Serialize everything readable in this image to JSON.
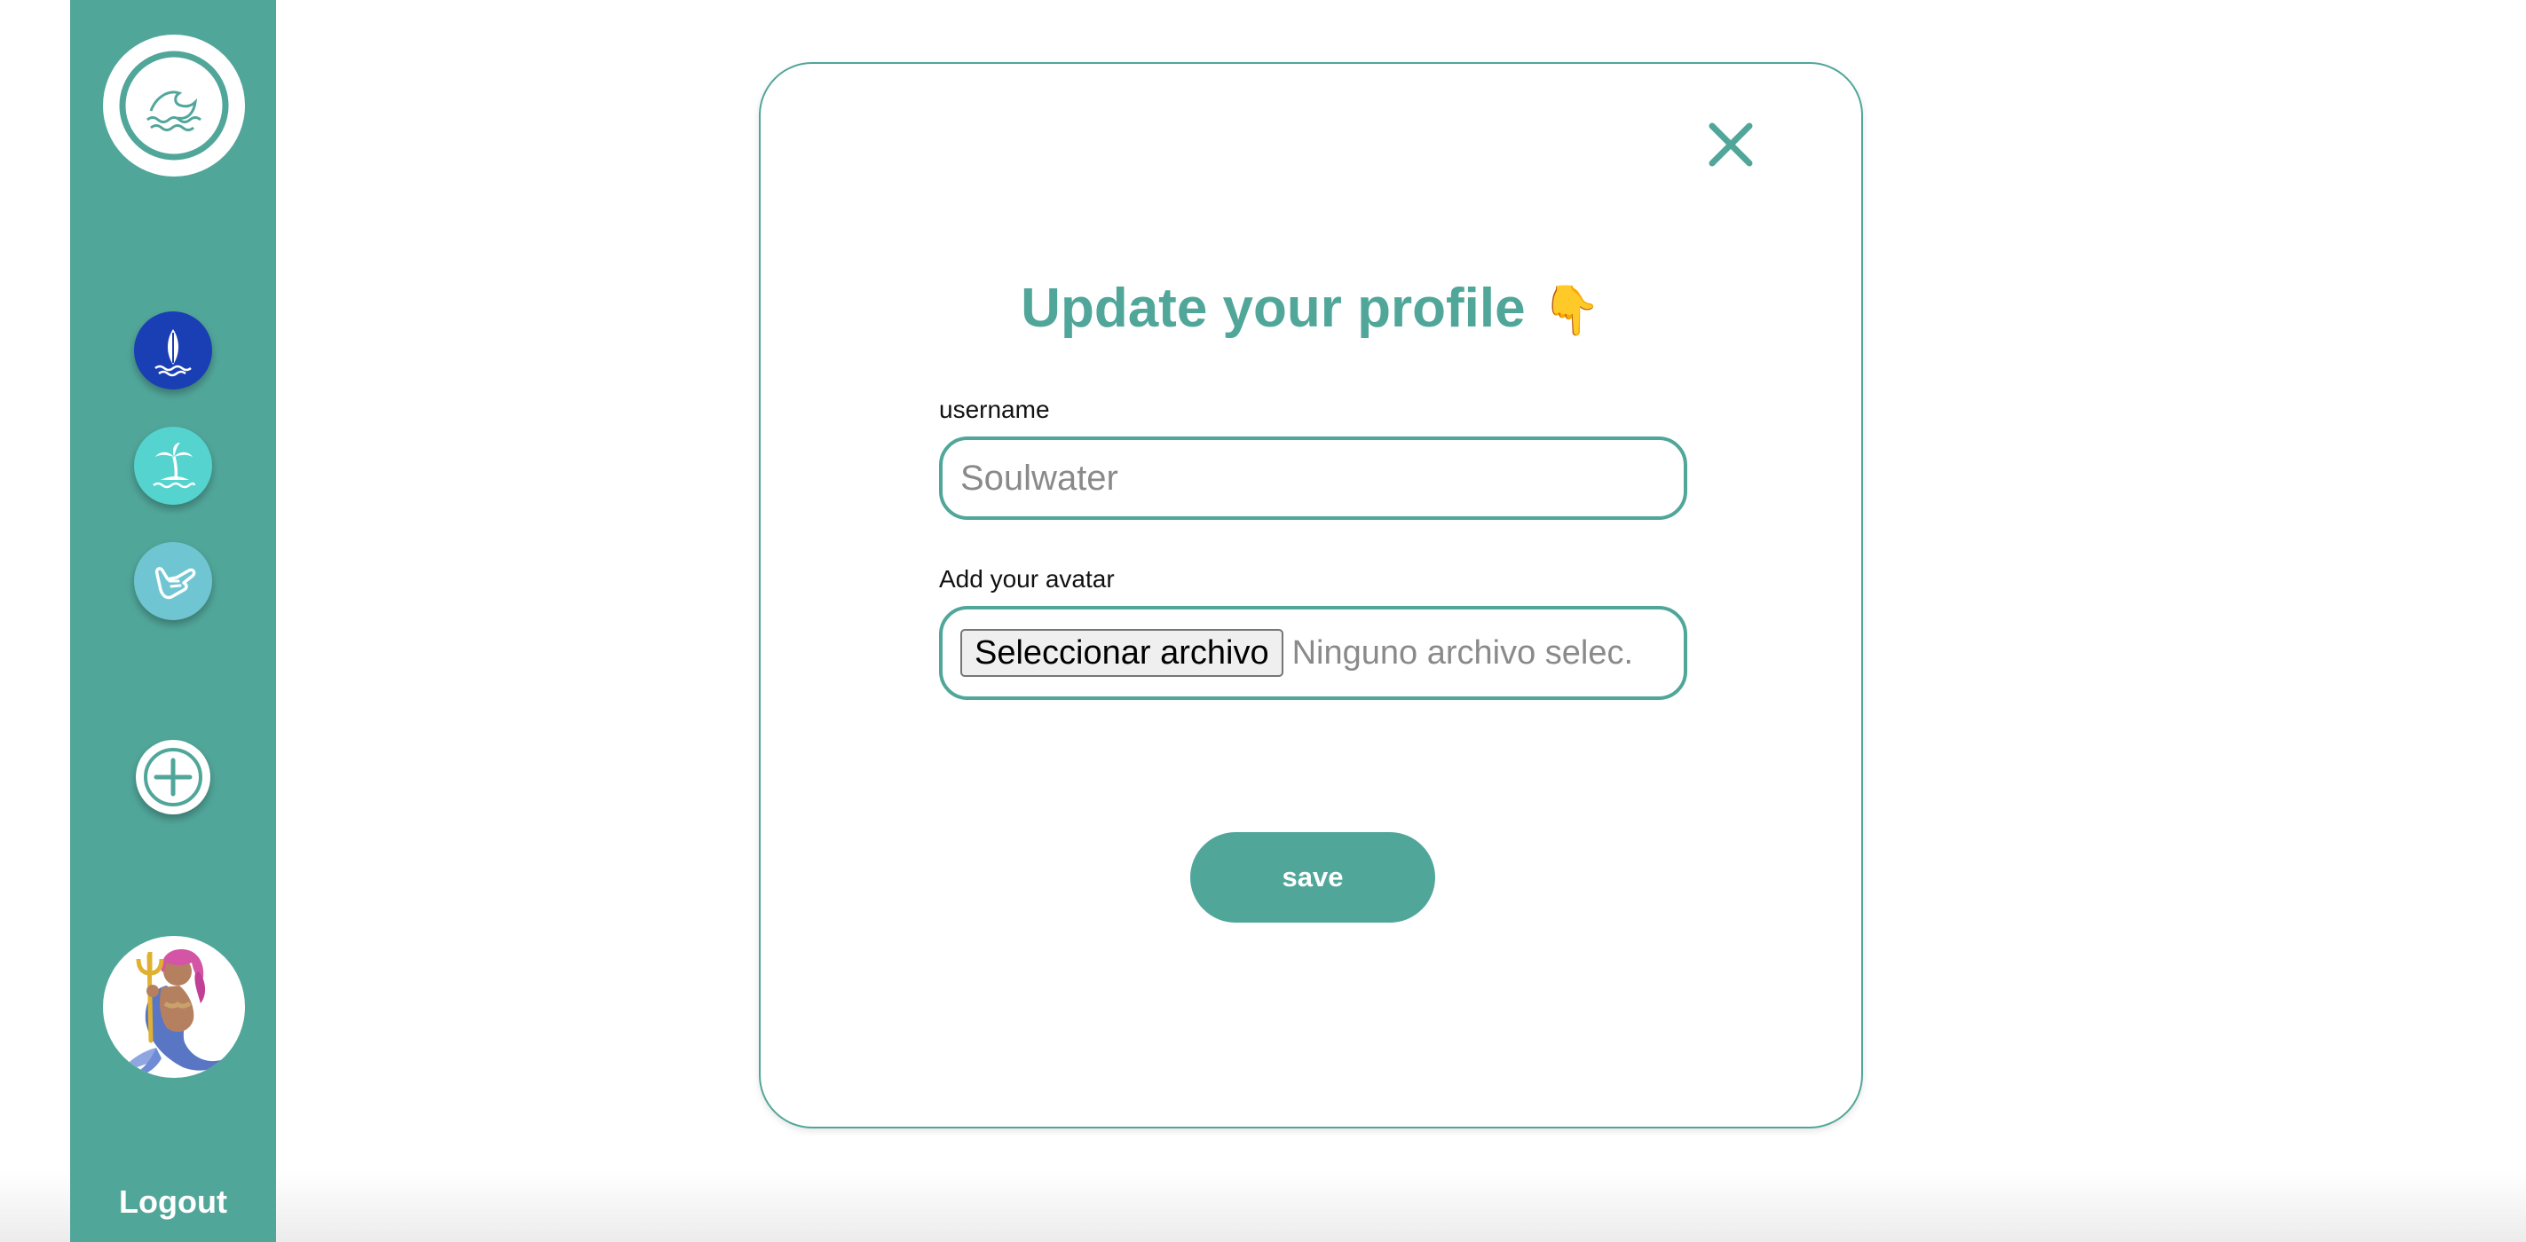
{
  "sidebar": {
    "logo_icon": "wave-icon",
    "nav_items": [
      {
        "icon": "surfboard-icon",
        "color": "#1a3fb4"
      },
      {
        "icon": "palm-island-icon",
        "color": "#55d3cf"
      },
      {
        "icon": "shaka-hand-icon",
        "color": "#6fc6d2"
      }
    ],
    "add_icon": "plus-icon",
    "avatar_icon": "mermaid-avatar",
    "logout_label": "Logout"
  },
  "modal": {
    "close_icon": "close-icon",
    "title": "Update your profile",
    "title_emoji": "👇",
    "username_label": "username",
    "username_placeholder": "Soulwater",
    "avatar_label": "Add your avatar",
    "file_button_label": "Seleccionar archivo",
    "file_status": "Ninguno archivo selec.",
    "save_label": "save"
  },
  "colors": {
    "accent": "#51a69a",
    "background": "#ffffff"
  }
}
